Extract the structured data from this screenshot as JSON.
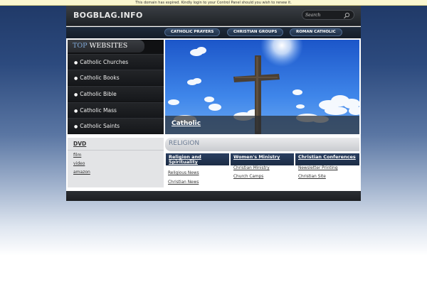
{
  "notice": "This domain has expired. Kindly login to your Control Panel should you wish to renew it.",
  "header": {
    "logo": "BOGBLAG.INFO",
    "search_placeholder": "Search"
  },
  "nav": [
    "CATHOLIC PRAYERS",
    "CHRISTIAN GROUPS",
    "ROMAN CATHOLIC"
  ],
  "top_websites": {
    "title_accent": "TOP",
    "title_rest": "WEBSITES",
    "items": [
      "Catholic Churches",
      "Catholic Books",
      "Catholic Bible",
      "Catholic Mass",
      "Catholic Saints"
    ]
  },
  "hero": {
    "caption": "Catholic"
  },
  "dvd": {
    "title": "DVD",
    "links": [
      "film",
      "video",
      "amazon"
    ]
  },
  "religion": {
    "title": "RELIGION",
    "columns": [
      {
        "heading": "Religion and Spirituality",
        "links": [
          "Religious News",
          "Christian News"
        ]
      },
      {
        "heading": "Women's Ministry",
        "links": [
          "Christian Ministry",
          "Church Camps"
        ]
      },
      {
        "heading": "Christian Conferences",
        "links": [
          "Newsletter Printing",
          "Christian Site"
        ]
      }
    ]
  },
  "colors": {
    "accent_blue": "#7fa8d8",
    "header_dark": "#1f2226",
    "nav_button": "#344a68",
    "column_header": "#2a3f60"
  }
}
